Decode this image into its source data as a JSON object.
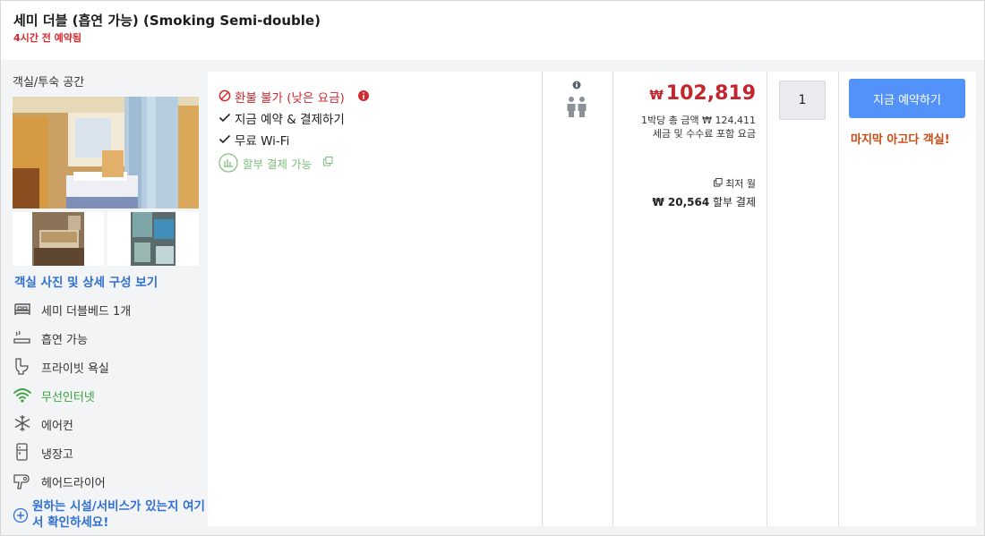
{
  "header": {
    "title": "세미 더블 (흡연 가능) (Smoking Semi-double)",
    "booked_note": "4시간 전 예약됨"
  },
  "room": {
    "section_title": "객실/투숙 공간",
    "photos_link": "객실 사진 및 상세 구성 보기",
    "amenities": [
      {
        "icon": "bed-icon",
        "label": "세미 더블베드 1개"
      },
      {
        "icon": "smoking-icon",
        "label": "흡연 가능"
      },
      {
        "icon": "toilet-icon",
        "label": "프라이빗 욕실"
      },
      {
        "icon": "wifi-icon",
        "label": "무선인터넷"
      },
      {
        "icon": "snowflake-icon",
        "label": "에어컨"
      },
      {
        "icon": "fridge-icon",
        "label": "냉장고"
      },
      {
        "icon": "hairdryer-icon",
        "label": "헤어드라이어"
      }
    ],
    "more_link": "원하는 시설/서비스가 있는지 여기서 확인하세요!"
  },
  "policies": {
    "refund": "환불 불가 (낮은 요금)",
    "pay_now": "지금 예약 & 결제하기",
    "wifi": "무료 Wi-Fi",
    "installment": "할부 결제 가능"
  },
  "price": {
    "currency": "₩",
    "amount": "102,819",
    "per_night_total": "1박당 총 금액 ₩ 124,411",
    "tax_note": "세금 및 수수료 포함 요금",
    "lowest_label": "최저 월",
    "monthly_amount": "₩ 20,564",
    "monthly_suffix": "할부 결제"
  },
  "booking": {
    "quantity": "1",
    "button_label": "지금 예약하기",
    "last_room": "마지막 아고다 객실!"
  },
  "colors": {
    "accent_blue": "#5392f9",
    "price_red": "#c1272d",
    "green": "#38a23b",
    "orange": "#c94a15"
  }
}
